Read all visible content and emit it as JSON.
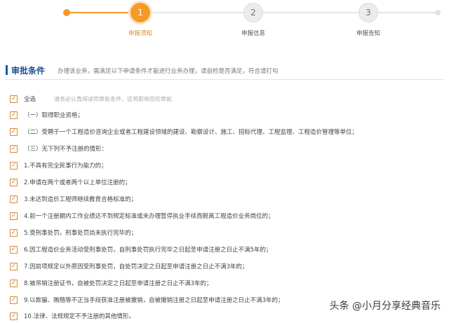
{
  "steps": [
    {
      "number": "1",
      "label": "申报须知",
      "state": "active"
    },
    {
      "number": "2",
      "label": "申报信息",
      "state": "idle"
    },
    {
      "number": "3",
      "label": "申报告知",
      "state": "idle"
    }
  ],
  "section": {
    "title": "审批条件",
    "note": "办理该业务，需满足以下申请条件才能进行业务办理，请自检是否满足，符合请打勾"
  },
  "select_all": {
    "label": "全选",
    "hint": "请务必认真阅读完审批条件，这将影响您的审批"
  },
  "conditions": [
    "（一）取得职业资格；",
    "（二）受聘于一个工程造价咨询企业或者工程建设领域的建设、勘察设计、施工、招标代理、工程监理、工程造价管理等单位；",
    "（三）无下列不予注册的情形：",
    "1.不具有完全民事行为能力的；",
    "2.申请在两个或者两个以上单位注册的；",
    "3.未达到造价工程师继续教育合格标准的；",
    "4.前一个注册期内工作业绩达不到规定标准或未办理暂停执业手续而脱离工程造价业务岗位的；",
    "5.受刑事处罚，刑事处罚尚未执行完毕的；",
    "6.因工程造价业务活动受刑事处罚，自刑事处罚执行完毕之日起至申请注册之日止不满5年的；",
    "7.因前项规定以外原因受刑事处罚，自处罚决定之日起至申请注册之日止不满3年的；",
    "8.被吊销注册证书，自被处罚决定之日起至申请注册之日止不满3年的；",
    "9.以欺骗、贿赂等不正当手段获准注册被撤销，自被撤销注册之日起至申请注册之日止不满3年的；",
    "10.法律、法规规定不予注册的其他情形。"
  ],
  "check_mark": "✓",
  "watermark": "头条 @小月分享经典音乐",
  "colors": {
    "accent": "#f39a2a",
    "section": "#1c4f8e"
  }
}
